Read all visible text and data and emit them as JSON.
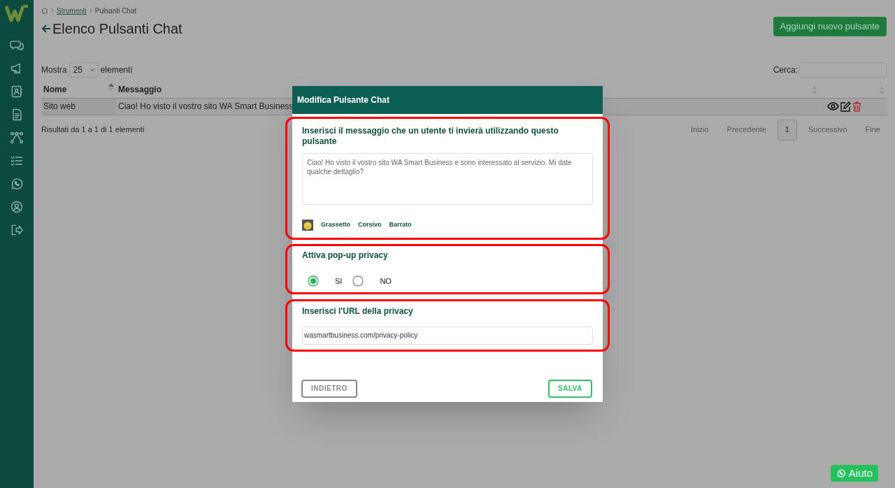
{
  "breadcrumb": [
    {
      "label": "Strumenti",
      "link": true
    },
    {
      "label": "Pulsanti Chat",
      "link": false
    }
  ],
  "page_title": "Elenco Pulsanti Chat",
  "add_button": "Aggiungi nuovo pulsante",
  "length_control": {
    "before": "Mostra",
    "value": "25",
    "after": "elementi"
  },
  "search": {
    "label": "Cerca:"
  },
  "table": {
    "columns": [
      "Nome",
      "Messaggio"
    ],
    "rows": [
      {
        "cells": [
          "Sito web",
          "Ciao! Ho visto il vostro sito WA Smart Business"
        ]
      }
    ]
  },
  "info": "Risultati da 1 a 1 di 1 elementi",
  "pagination": [
    {
      "label": "Inizio",
      "selected": false
    },
    {
      "label": "Precedente",
      "selected": false
    },
    {
      "label": "1",
      "selected": true
    },
    {
      "label": "Successivo",
      "selected": false
    },
    {
      "label": "Fine",
      "selected": false
    }
  ],
  "modal": {
    "title": "Modifica Pulsante Chat",
    "message_section": {
      "label": "Inserisci il messaggio che un utente ti invierà utilizzando questo pulsante",
      "value": "Ciao! Ho visto il vostro sito WA Smart Business e sono interessato al servizio. Mi date qualche dettaglio?",
      "format_buttons": [
        "Grassetto",
        "Corsivo",
        "Barrato"
      ]
    },
    "privacy_section": {
      "label": "Attiva pop-up privacy",
      "options": [
        {
          "label": "SI",
          "selected": true
        },
        {
          "label": "NO",
          "selected": false
        }
      ]
    },
    "url_section": {
      "label": "Inserisci l'URL della privacy",
      "value": "wasmartbusiness.com/privacy-policy"
    },
    "buttons": [
      {
        "label": "INDIETRO",
        "kind": "secondary"
      },
      {
        "label": "SALVA",
        "kind": "primary"
      }
    ]
  },
  "help_button": "Aiuto"
}
